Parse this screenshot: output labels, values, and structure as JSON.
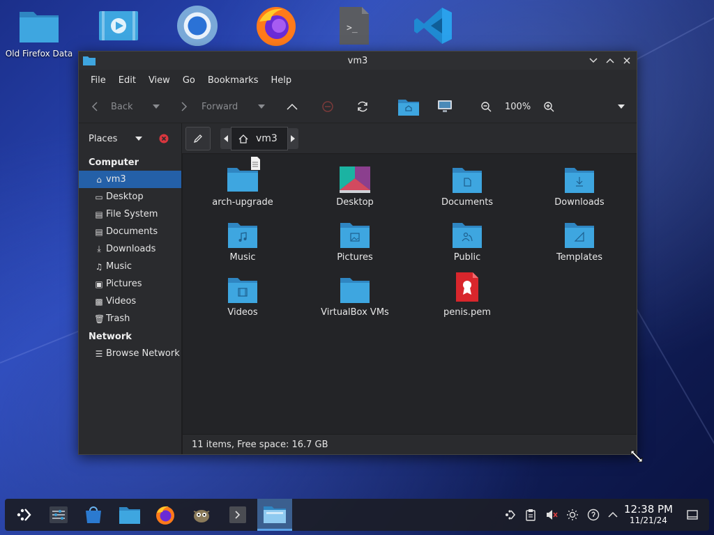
{
  "desktop": {
    "icons": [
      {
        "label": "Old Firefox Data",
        "icon": "folder-icon"
      },
      {
        "label": "",
        "icon": "video-file-icon"
      },
      {
        "label": "",
        "icon": "chromium-icon"
      },
      {
        "label": "",
        "icon": "firefox-icon"
      },
      {
        "label": "",
        "icon": "terminal-icon"
      },
      {
        "label": "",
        "icon": "vscode-icon"
      }
    ]
  },
  "window": {
    "title": "vm3",
    "menu": [
      "File",
      "Edit",
      "View",
      "Go",
      "Bookmarks",
      "Help"
    ],
    "toolbar": {
      "back_label": "Back",
      "forward_label": "Forward",
      "zoom": "100%"
    },
    "places_label": "Places",
    "breadcrumb": "vm3",
    "sidebar": {
      "computer_header": "Computer",
      "computer_items": [
        {
          "label": "vm3",
          "icon": "home-icon",
          "selected": true
        },
        {
          "label": "Desktop",
          "icon": "desktop-icon"
        },
        {
          "label": "File System",
          "icon": "drive-icon"
        },
        {
          "label": "Documents",
          "icon": "document-icon"
        },
        {
          "label": "Downloads",
          "icon": "download-icon"
        },
        {
          "label": "Music",
          "icon": "music-icon"
        },
        {
          "label": "Pictures",
          "icon": "picture-icon"
        },
        {
          "label": "Videos",
          "icon": "video-icon"
        },
        {
          "label": "Trash",
          "icon": "trash-icon"
        }
      ],
      "network_header": "Network",
      "network_items": [
        {
          "label": "Browse Network",
          "icon": "network-icon"
        }
      ]
    },
    "files": [
      {
        "name": "arch-upgrade",
        "type": "folder-with-file"
      },
      {
        "name": "Desktop",
        "type": "desktop-folder"
      },
      {
        "name": "Documents",
        "type": "folder"
      },
      {
        "name": "Downloads",
        "type": "folder"
      },
      {
        "name": "Music",
        "type": "folder"
      },
      {
        "name": "Pictures",
        "type": "folder"
      },
      {
        "name": "Public",
        "type": "folder"
      },
      {
        "name": "Templates",
        "type": "folder"
      },
      {
        "name": "Videos",
        "type": "folder"
      },
      {
        "name": "VirtualBox VMs",
        "type": "folder"
      },
      {
        "name": "penis.pem",
        "type": "certificate-file"
      }
    ],
    "status": "11 items, Free space: 16.7 GB"
  },
  "taskbar": {
    "apps": [
      "app-launcher-icon",
      "settings-icon",
      "discover-icon",
      "files-icon",
      "firefox-icon",
      "gimp-icon",
      "terminal-icon",
      "pcmanfm-icon"
    ],
    "time": "12:38 PM",
    "date": "11/21/24"
  },
  "colors": {
    "accent": "#2460a8",
    "folder": "#3aa0d8",
    "window_bg": "#2a2b2e"
  }
}
